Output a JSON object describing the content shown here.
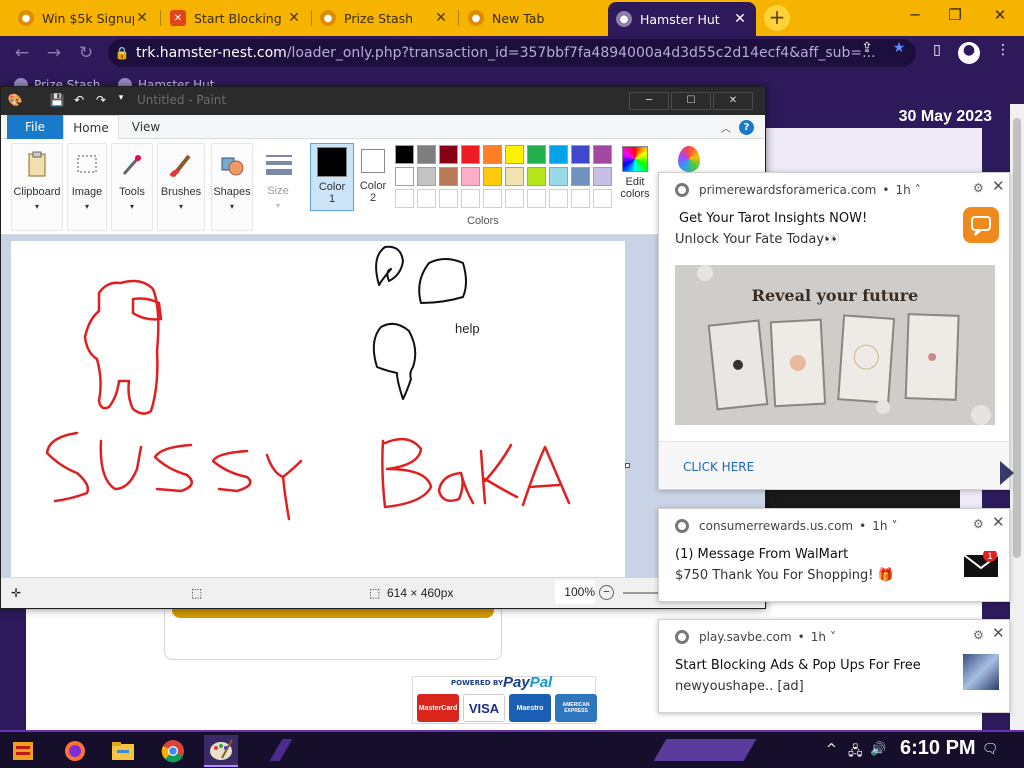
{
  "browser": {
    "tabs": [
      {
        "title": "Win $5k Signup",
        "favicon_color": "#f09a00",
        "favicon": "chrome-icon"
      },
      {
        "title": "Start Blocking",
        "favicon_color": "#e0441a",
        "favicon": "brave-icon"
      },
      {
        "title": "Prize Stash",
        "favicon_color": "#f09a00",
        "favicon": "chrome-icon"
      },
      {
        "title": "New Tab",
        "favicon_color": "#f09a00",
        "favicon": "chrome-icon"
      },
      {
        "title": "Hamster Hut",
        "favicon_color": "#8c7fae",
        "favicon": "chrome-icon",
        "active": true
      }
    ],
    "window_controls": {
      "minimize": "─",
      "restore": "❐",
      "close": "✕"
    },
    "url_host": "trk.hamster-nest.com",
    "url_rest": "/loader_only.php?transaction_id=357bbf7fa4894000a4d3d55c2d14ecf4&aff_sub=...",
    "bookmarks": [
      {
        "label": "Prize Stash"
      },
      {
        "label": "Hamster Hut"
      }
    ]
  },
  "page": {
    "date": "30 May 2023",
    "paypal": {
      "powered_by": "POWERED BY",
      "brand_a": "Pay",
      "brand_b": "Pal",
      "cards": [
        "MasterCard",
        "VISA",
        "Maestro",
        "AMERICAN EXPRESS"
      ]
    }
  },
  "paint": {
    "window_title": "Untitled - Paint",
    "ribbon_tabs": [
      "File",
      "Home",
      "View"
    ],
    "groups": {
      "clipboard": "Clipboard",
      "image": "Image",
      "tools": "Tools",
      "brushes": "Brushes",
      "shapes": "Shapes",
      "size": "Size"
    },
    "color1_label": "Color\n1",
    "color1_a": "Color",
    "color1_b": "1",
    "color2_a": "Color",
    "color2_b": "2",
    "edit_colors_a": "Edit",
    "edit_colors_b": "colors",
    "colors_label": "Colors",
    "palette_row1": [
      "#000000",
      "#7f7f7f",
      "#880015",
      "#ed1c24",
      "#ff7f27",
      "#fff200",
      "#22b14c",
      "#00a2e8",
      "#3f48cc",
      "#a349a4"
    ],
    "palette_row2": [
      "#ffffff",
      "#c3c3c3",
      "#b97a57",
      "#ffaec9",
      "#ffc90e",
      "#efe4b0",
      "#b5e61d",
      "#99d9ea",
      "#7092be",
      "#c8bfe7"
    ],
    "color1": "#000000",
    "color2": "#ffffff",
    "canvas_text": {
      "help": "help"
    },
    "status": {
      "dimensions": "614 × 460px",
      "zoom": "100%"
    }
  },
  "notifications": [
    {
      "source": "primerewardsforamerica.com",
      "age": "1h",
      "title": "Get Your Tarot Insights NOW!",
      "body": "Unlock Your Fate Today👀",
      "image_caption": "Reveal your future",
      "cta": "CLICK HERE"
    },
    {
      "source": "consumerrewards.us.com",
      "age": "1h",
      "title": "(1) Message From WalMart",
      "body": "$750 Thank You For Shopping! 🎁",
      "badge": "1"
    },
    {
      "source": "play.savbe.com",
      "age": "1h",
      "title": "Start Blocking Ads & Pop Ups For Free",
      "body": "newyoushape.. [ad]"
    }
  ],
  "taskbar": {
    "clock": "6:10 PM",
    "apps": [
      "start-icon",
      "firefox-icon",
      "file-explorer-icon",
      "chrome-icon",
      "paint-icon"
    ]
  }
}
